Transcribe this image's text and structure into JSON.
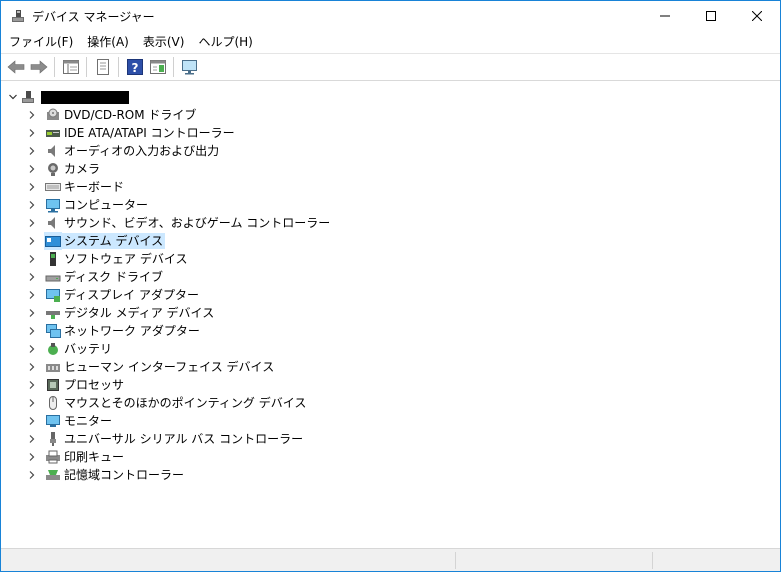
{
  "window": {
    "title": "デバイス マネージャー",
    "accent": "#1883d7"
  },
  "menu": [
    "ファイル(F)",
    "操作(A)",
    "表示(V)",
    "ヘルプ(H)"
  ],
  "toolbar": {
    "buttons": [
      "back-icon",
      "forward-icon",
      "properties-pane-icon",
      "page-icon",
      "help-icon",
      "action-pane-icon",
      "monitor-icon"
    ]
  },
  "tree": {
    "root_label": "",
    "categories": [
      "DVD/CD-ROM ドライブ",
      "IDE ATA/ATAPI コントローラー",
      "オーディオの入力および出力",
      "カメラ",
      "キーボード",
      "コンピューター",
      "サウンド、ビデオ、およびゲーム コントローラー",
      "システム デバイス",
      "ソフトウェア デバイス",
      "ディスク ドライブ",
      "ディスプレイ アダプター",
      "デジタル メディア デバイス",
      "ネットワーク アダプター",
      "バッテリ",
      "ヒューマン インターフェイス デバイス",
      "プロセッサ",
      "マウスとそのほかのポインティング デバイス",
      "モニター",
      "ユニバーサル シリアル バス コントローラー",
      "印刷キュー",
      "記憶域コントローラー"
    ],
    "selected_index": 7,
    "selection_color": "#cce8ff"
  }
}
